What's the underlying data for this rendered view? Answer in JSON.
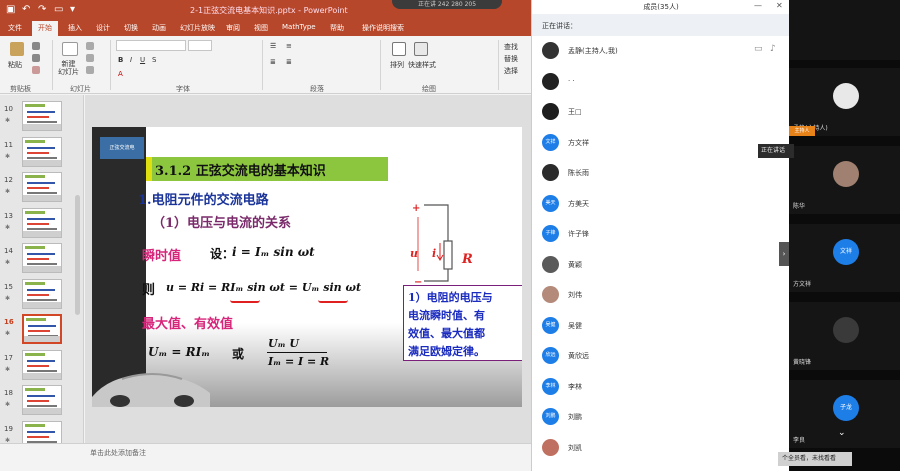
{
  "titlebar": {
    "doc_title": "2-1正弦交流电基本知识.pptx - PowerPoint",
    "rec_pill": "正在讲 242 280 205"
  },
  "ribbon": {
    "tabs": [
      "文件",
      "开始",
      "插入",
      "设计",
      "切换",
      "动画",
      "幻灯片放映",
      "审阅",
      "视图",
      "MathType",
      "帮助",
      "操作说明搜索"
    ],
    "active_tab": "开始",
    "paste_label": "粘贴",
    "new_slide_label": "新建\n幻灯片",
    "groups": [
      "剪贴板",
      "幻灯片",
      "字体",
      "段落",
      "绘图"
    ],
    "arrange_label": "排列",
    "quick_styles_label": "快速样式",
    "find_label": "查找",
    "replace_label": "替换",
    "select_label": "选择"
  },
  "thumbnails": [
    {
      "num": "10",
      "active": false
    },
    {
      "num": "11",
      "active": false
    },
    {
      "num": "12",
      "active": false
    },
    {
      "num": "13",
      "active": false
    },
    {
      "num": "14",
      "active": false
    },
    {
      "num": "15",
      "active": false
    },
    {
      "num": "16",
      "active": true
    },
    {
      "num": "17",
      "active": false
    },
    {
      "num": "18",
      "active": false
    },
    {
      "num": "19",
      "active": false
    }
  ],
  "slide": {
    "logo_text": "正弦交流电",
    "heading": "3.1.2  正弦交流电的基本知识",
    "sub1": "1.电阻元件的交流电路",
    "sub2": "（1）电压与电流的关系",
    "instant_label": "瞬时值",
    "set_label": "设：",
    "formula_i": "i = Iₘ sin ωt",
    "then_label": "则",
    "formula_u": "u = Ri = RIₘ sin ωt = Uₘ sin ωt",
    "maxrms_label": "最大值、有效值",
    "formula_um": "Uₘ = RIₘ",
    "or_label": "或",
    "frac_num": "Uₘ    U",
    "frac_den": "Iₘ  =  I  = R",
    "note_lines": [
      "1）电阻的电压与",
      "电流瞬时值、有",
      "效值、最大值都",
      "满足欧姆定律。"
    ],
    "circuit": {
      "plus": "+",
      "minus": "−",
      "u": "u",
      "i": "i",
      "r": "R"
    }
  },
  "statusbar": {
    "notes_prompt": "单击此处添加备注"
  },
  "members": {
    "title": "成员(35人)",
    "speaking": "正在讲话：",
    "list": [
      {
        "name": "孟静(主持人,我)",
        "avatar": "",
        "color": "#333333"
      },
      {
        "name": "·  ·",
        "avatar": "",
        "color": "#222222"
      },
      {
        "name": "王□",
        "avatar": "",
        "color": "#1e1e1e"
      },
      {
        "name": "方文祥",
        "avatar": "文祥",
        "color": "#1e7ee8"
      },
      {
        "name": "陈长雨",
        "avatar": "",
        "color": "#2b2b2b"
      },
      {
        "name": "方美天",
        "avatar": "美天",
        "color": "#1e7ee8"
      },
      {
        "name": "许子锋",
        "avatar": "子锋",
        "color": "#1e7ee8"
      },
      {
        "name": "黄颖",
        "avatar": "",
        "color": "#5a5a5a"
      },
      {
        "name": "刘伟",
        "avatar": "",
        "color": "#b48a7a"
      },
      {
        "name": "吴健",
        "avatar": "吴健",
        "color": "#1e7ee8"
      },
      {
        "name": "黄欣远",
        "avatar": "欣远",
        "color": "#1e7ee8"
      },
      {
        "name": "李林",
        "avatar": "李林",
        "color": "#1e7ee8"
      },
      {
        "name": "刘鹏",
        "avatar": "刘鹏",
        "color": "#1e7ee8"
      },
      {
        "name": "刘凯",
        "avatar": "",
        "color": "#c07060"
      }
    ]
  },
  "videos": {
    "host_badge": "主持人",
    "tiles": [
      {
        "name": "孟静(主持人)",
        "avatar": "",
        "color": "#e8e8e8"
      },
      {
        "name": "陈华",
        "avatar": "",
        "color": "#a08070"
      },
      {
        "name": "方文祥",
        "avatar": "文祥",
        "color": "#1e7ee8"
      },
      {
        "name": "黄晓锋",
        "avatar": "",
        "color": "#3a3a3a"
      },
      {
        "name": "李良",
        "avatar": "子龙",
        "color": "#1e7ee8"
      }
    ],
    "tooltip": "正在讲话",
    "hint": "个全员看，未找看看"
  }
}
